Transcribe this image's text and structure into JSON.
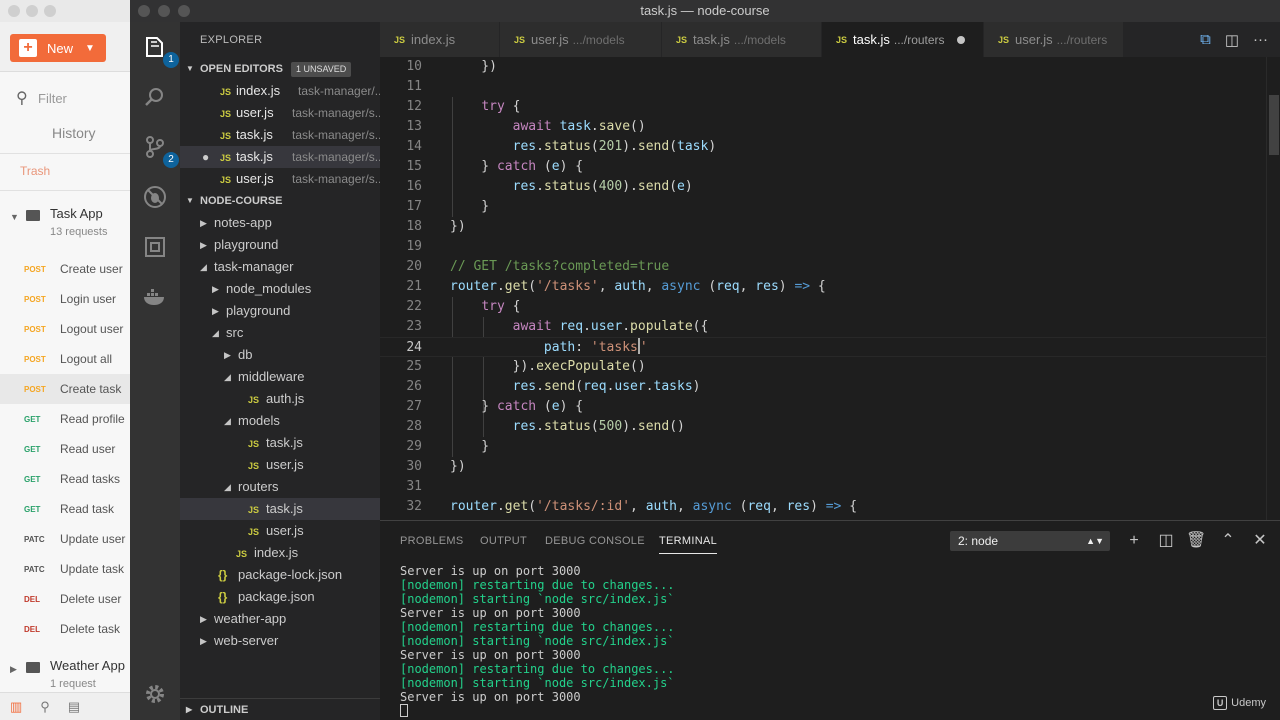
{
  "window_title": "task.js — node-course",
  "postman": {
    "new_label": "New",
    "filter_placeholder": "Filter",
    "history_label": "History",
    "trash_label": "Trash",
    "collections": [
      {
        "name": "Task App",
        "count": "13 requests"
      },
      {
        "name": "Weather App",
        "count": "1 request"
      }
    ],
    "requests": [
      {
        "method": "POST",
        "name": "Create user",
        "color": "#f5a623"
      },
      {
        "method": "POST",
        "name": "Login user",
        "color": "#f5a623"
      },
      {
        "method": "POST",
        "name": "Logout user",
        "color": "#f5a623"
      },
      {
        "method": "POST",
        "name": "Logout all",
        "color": "#f5a623"
      },
      {
        "method": "POST",
        "name": "Create task",
        "color": "#f5a623"
      },
      {
        "method": "GET",
        "name": "Read profile",
        "color": "#2aa16a"
      },
      {
        "method": "GET",
        "name": "Read user",
        "color": "#2aa16a"
      },
      {
        "method": "GET",
        "name": "Read tasks",
        "color": "#2aa16a"
      },
      {
        "method": "GET",
        "name": "Read task",
        "color": "#2aa16a"
      },
      {
        "method": "PATC",
        "name": "Update user",
        "color": "#555555"
      },
      {
        "method": "PATC",
        "name": "Update task",
        "color": "#555555"
      },
      {
        "method": "DEL",
        "name": "Delete user",
        "color": "#c0392b"
      },
      {
        "method": "DEL",
        "name": "Delete task",
        "color": "#c0392b"
      }
    ]
  },
  "activity_bar": {
    "scm_badge": "2",
    "explorer_badge": "1"
  },
  "sidebar": {
    "header": "EXPLORER",
    "open_editors_label": "OPEN EDITORS",
    "unsaved_badge": "1 UNSAVED",
    "open_editors": [
      {
        "name": "index.js",
        "path": "task-manager/..."
      },
      {
        "name": "user.js",
        "path": "task-manager/s..."
      },
      {
        "name": "task.js",
        "path": "task-manager/s..."
      },
      {
        "name": "task.js",
        "path": "task-manager/s..."
      },
      {
        "name": "user.js",
        "path": "task-manager/s..."
      }
    ],
    "folder_label": "NODE-COURSE",
    "tree": [
      {
        "label": "notes-app"
      },
      {
        "label": "playground"
      },
      {
        "label": "task-manager"
      },
      {
        "label": "node_modules"
      },
      {
        "label": "playground"
      },
      {
        "label": "src"
      },
      {
        "label": "db"
      },
      {
        "label": "middleware"
      },
      {
        "label": "auth.js"
      },
      {
        "label": "models"
      },
      {
        "label": "task.js"
      },
      {
        "label": "user.js"
      },
      {
        "label": "routers"
      },
      {
        "label": "task.js"
      },
      {
        "label": "user.js"
      },
      {
        "label": "index.js"
      },
      {
        "label": "package-lock.json"
      },
      {
        "label": "package.json"
      },
      {
        "label": "weather-app"
      },
      {
        "label": "web-server"
      }
    ],
    "outline_label": "OUTLINE"
  },
  "tabs": [
    {
      "name": "index.js",
      "path": ""
    },
    {
      "name": "user.js",
      "path": ".../models"
    },
    {
      "name": "task.js",
      "path": ".../models"
    },
    {
      "name": "task.js",
      "path": ".../routers"
    },
    {
      "name": "user.js",
      "path": ".../routers"
    }
  ],
  "code": {
    "line_numbers": [
      "10",
      "11",
      "12",
      "13",
      "14",
      "15",
      "16",
      "17",
      "18",
      "19",
      "20",
      "21",
      "22",
      "23",
      "24",
      "25",
      "26",
      "27",
      "28",
      "29",
      "30",
      "31",
      "32"
    ],
    "current_line": "24"
  },
  "panel": {
    "tabs": [
      "PROBLEMS",
      "OUTPUT",
      "DEBUG CONSOLE",
      "TERMINAL"
    ],
    "terminal_select": "2: node",
    "terminal_lines": [
      "Server is up on port 3000",
      "[nodemon] restarting due to changes...",
      "[nodemon] starting `node src/index.js`",
      "Server is up on port 3000",
      "[nodemon] restarting due to changes...",
      "[nodemon] starting `node src/index.js`",
      "Server is up on port 3000",
      "[nodemon] restarting due to changes...",
      "[nodemon] starting `node src/index.js`",
      "Server is up on port 3000"
    ],
    "watermark": "Udemy"
  }
}
